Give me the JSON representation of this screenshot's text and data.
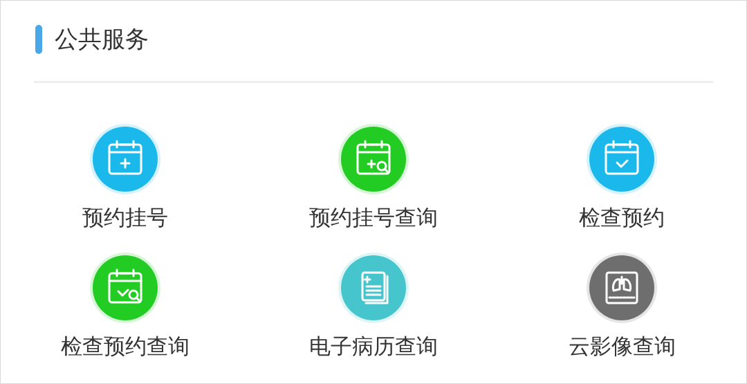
{
  "section": {
    "title": "公共服务"
  },
  "services": [
    {
      "label": "预约挂号",
      "kind": "calendar-plus",
      "color": "#1bb8ec"
    },
    {
      "label": "预约挂号查询",
      "kind": "calendar-plus-search",
      "color": "#22cc22"
    },
    {
      "label": "检查预约",
      "kind": "calendar-check",
      "color": "#1bb8ec"
    },
    {
      "label": "检查预约查询",
      "kind": "calendar-check-search",
      "color": "#22cc22"
    },
    {
      "label": "电子病历查询",
      "kind": "document",
      "color": "#46c6cc"
    },
    {
      "label": "云影像查询",
      "kind": "xray",
      "color": "#6e6e6e"
    }
  ]
}
